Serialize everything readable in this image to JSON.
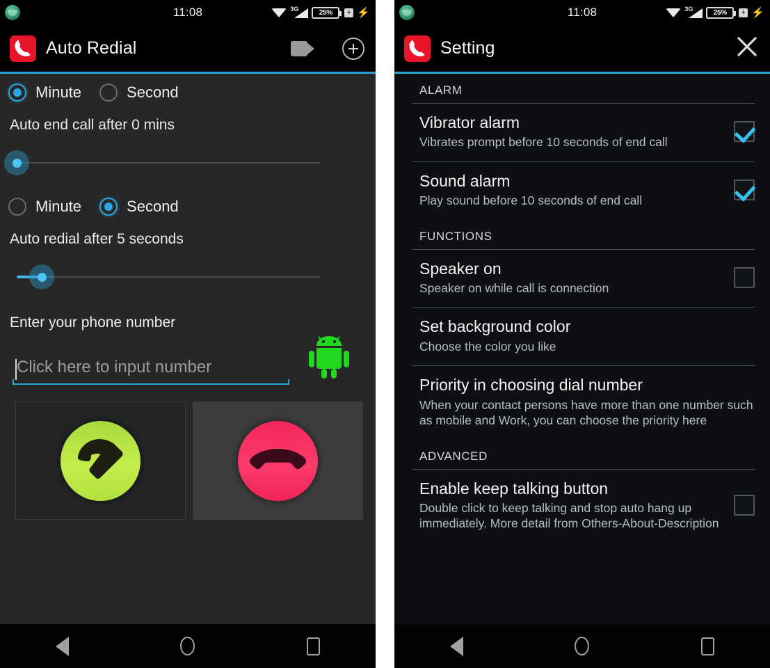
{
  "status_bar": {
    "time": "11:08",
    "notification_icon": "green-app-notification-icon",
    "wifi_icon": "wifi-icon",
    "network_label": "3G",
    "battery_percent": "25%",
    "charging_icon": "charging-bolt-icon"
  },
  "left_screen": {
    "app_bar": {
      "logo_icon": "phone-handset-app-logo",
      "title": "Auto Redial",
      "video_icon": "video-camera-icon",
      "add_icon": "plus-circle-icon"
    },
    "end_call_group": {
      "options": [
        {
          "label": "Minute",
          "selected": true
        },
        {
          "label": "Second",
          "selected": false
        }
      ],
      "description": "Auto end call after 0 mins",
      "slider_value": 0,
      "slider_min": 0,
      "slider_max": 100
    },
    "redial_group": {
      "options": [
        {
          "label": "Minute",
          "selected": false
        },
        {
          "label": "Second",
          "selected": true
        }
      ],
      "description": "Auto redial after 5 seconds",
      "slider_value": 8,
      "slider_min": 0,
      "slider_max": 100
    },
    "phone_field": {
      "label": "Enter your phone number",
      "value": "",
      "placeholder": "Click here to input number",
      "contact_picker_icon": "android-robot-icon"
    },
    "actions": {
      "call_icon": "green-call-button-icon",
      "hangup_icon": "red-hangup-button-icon"
    }
  },
  "right_screen": {
    "app_bar": {
      "logo_icon": "phone-handset-app-logo",
      "title": "Setting",
      "close_icon": "close-x-icon"
    },
    "groups": [
      {
        "header": "ALARM",
        "items": [
          {
            "title": "Vibrator alarm",
            "subtitle": "Vibrates prompt before 10 seconds of end call",
            "has_checkbox": true,
            "checked": true
          },
          {
            "title": "Sound alarm",
            "subtitle": "Play sound before 10 seconds of end call",
            "has_checkbox": true,
            "checked": true
          }
        ]
      },
      {
        "header": "FUNCTIONS",
        "items": [
          {
            "title": "Speaker on",
            "subtitle": "Speaker on while call is connection",
            "has_checkbox": true,
            "checked": false
          },
          {
            "title": "Set background color",
            "subtitle": "Choose the color you like",
            "has_checkbox": false,
            "checked": false
          },
          {
            "title": "Priority in choosing dial number",
            "subtitle": "When your contact persons have more than one number such as mobile and Work, you can choose the priority here",
            "has_checkbox": false,
            "checked": false
          }
        ]
      },
      {
        "header": "ADVANCED",
        "items": [
          {
            "title": "Enable keep talking button",
            "subtitle": "Double click to keep talking and stop auto hang up immediately. More detail from Others-About-Description",
            "has_checkbox": true,
            "checked": false
          }
        ]
      }
    ]
  },
  "nav_bar": {
    "back_icon": "back-triangle-icon",
    "home_icon": "home-circle-icon",
    "recents_icon": "recent-apps-square-icon"
  },
  "colors": {
    "accent": "#2aa3d8",
    "slider_thumb": "#4cc3f2",
    "logo_red": "#e8152a",
    "call_green": "#c3ee4a",
    "hangup_red": "#fb3b6b",
    "checkbox_check": "#35c2f0"
  }
}
